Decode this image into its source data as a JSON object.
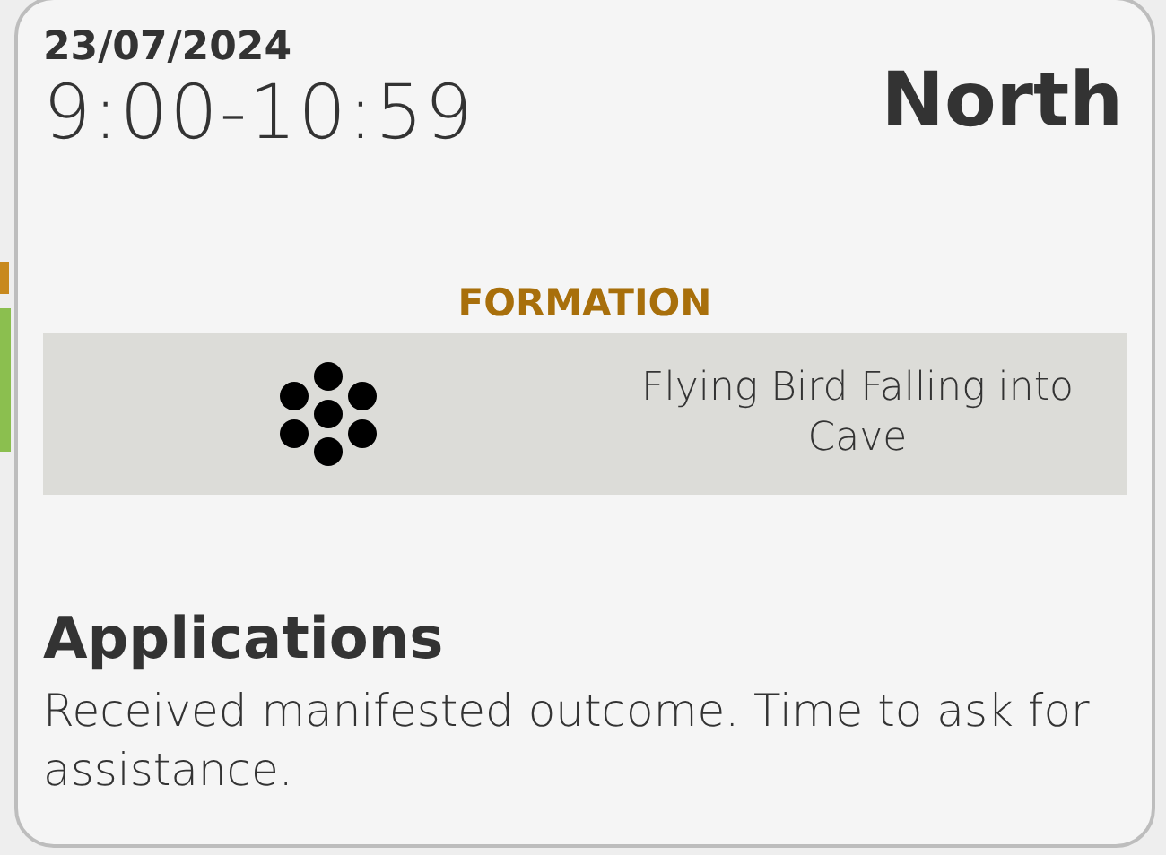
{
  "popup": {
    "date": "23/07/2024",
    "time": "9:00-10:59",
    "location": "North",
    "formation": {
      "label": "FORMATION",
      "name": "Flying Bird Falling into Cave"
    },
    "section": {
      "title": "Applications",
      "text": "Received manifested outcome. Time to ask for assistance."
    }
  }
}
